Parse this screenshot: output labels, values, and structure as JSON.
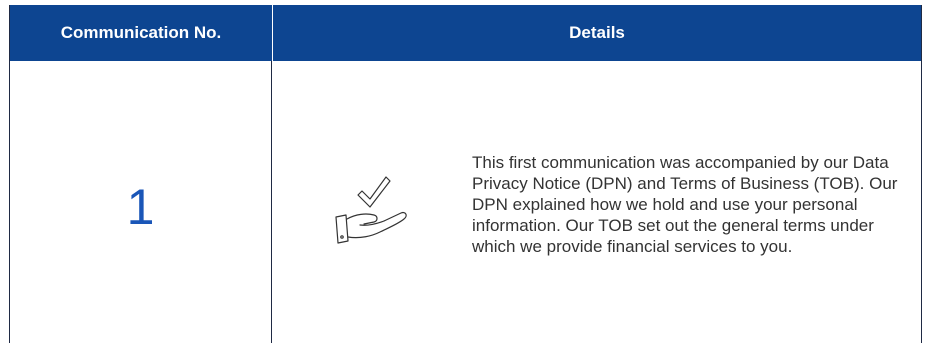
{
  "table": {
    "headers": {
      "number": "Communication No.",
      "details": "Details"
    },
    "rows": [
      {
        "number": "1",
        "icon": "hand-checkmark-icon",
        "details": "This first communication was accompanied by our Data Privacy Notice (DPN) and Terms of Business (TOB). Our DPN explained how we hold and use your personal information. Our TOB set out the general terms under which we provide financial services to you."
      }
    ]
  },
  "colors": {
    "header_background": "#0d4591",
    "header_text": "#ffffff",
    "number_text": "#1a56b8",
    "body_text": "#333333"
  }
}
